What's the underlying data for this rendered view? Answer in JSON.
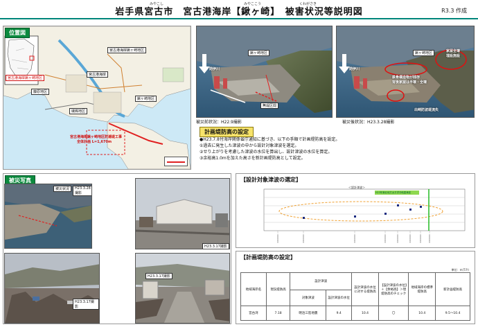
{
  "header": {
    "title": "岩手県宮古市　宮古港海岸【鍬ヶ崎】　被害状況等説明図",
    "ruby_miyako": "みやこし",
    "ruby_miyakoko": "みやここう",
    "ruby_kuwagasaki": "くわがさき",
    "date": "R3.3 作成"
  },
  "location": {
    "label": "位置図",
    "inset_caption": "宮古港海岸鍬ヶ崎地区",
    "place_1": "宮古港海岸鍬ヶ崎地区",
    "place_2": "宮古港海岸",
    "place_3": "藤原地区",
    "place_4": "磯鶏地区",
    "place_5": "鍬ヶ崎地区",
    "plan_line1": "宮古港海岸鍬ヶ崎地区防潮堤工事",
    "plan_line2": "全体計画 L=1,670m"
  },
  "aerial_before": {
    "caption": "被災前状況：H22.9撮影",
    "area_label": "鍬ヶ崎地区",
    "gap_label": "無堤区間",
    "sea_label": "閉伊川"
  },
  "aerial_after": {
    "caption": "被災後状況：H23.3.28撮影",
    "area_label": "鍬ヶ崎地区",
    "damage_1": "家屋全壊",
    "damage_1b": "埋設施設",
    "damage_2": "鉄骨構造物が残存",
    "damage_2b": "背後家屋は半壊・全壊",
    "damage_3": "出崎防波堤流失",
    "sea_label": "閉伊川"
  },
  "plan_setting": {
    "label": "計画堤防高の設定",
    "line1": "●H23.7.8付海岸関係省庁通知に基づき、以下の手順で計画堤防高を設定。",
    "line2": "①過去に発生した津波の中から設計対象津波を選定。",
    "line3": "②せり上がりを考慮した津波の水位を算出し、設計津波の水位を算定。",
    "line4": "③余裕高1.0mを加えた高さを新計画堤防高として設定。"
  },
  "disaster_photos": {
    "label": "被災写真",
    "cap_1": "被災状況",
    "cap_1b": "H23.3.28撮影",
    "cap_2": "H23.3.17撮影",
    "cap_3": "H23.3.17撮影",
    "cap_4": "H23.3.17撮影"
  },
  "tsunami_selection": {
    "label": "【設計対象津波の選定】",
    "chart_header": "＜設計津波＞",
    "green_tag": "H23年東北地方太平洋沖地震津波"
  },
  "dike_table": {
    "label": "【計画堤防高の設定】",
    "unit": "単位：m(T.P.)",
    "h_area": "地域海岸名",
    "h_current": "現況堤防高",
    "h_design_group": "設計津波",
    "h_design_name": "対象津波",
    "h_design_level": "設計津波の水位",
    "h_plan_level": "設計津波の水位に対する堤防高",
    "h_check": "【設計津波の水位】＋【余裕高】＞現堤防高のチェック",
    "h_local": "地域海岸の標準堤防高",
    "h_new": "新計画堤防高",
    "r_area": "宮古湾",
    "r_current": "7.18",
    "r_name": "明治三陸地震",
    "r_level": "9.4",
    "r_plan": "10.4",
    "r_check": "〇",
    "r_local": "10.4",
    "r_new": "9.5～10.4"
  },
  "colors": {
    "accent_green": "#0c8a3e",
    "highlight_yellow": "#f7e36a",
    "damage_red": "#d01010",
    "sea_blue": "#bfe3f5"
  }
}
